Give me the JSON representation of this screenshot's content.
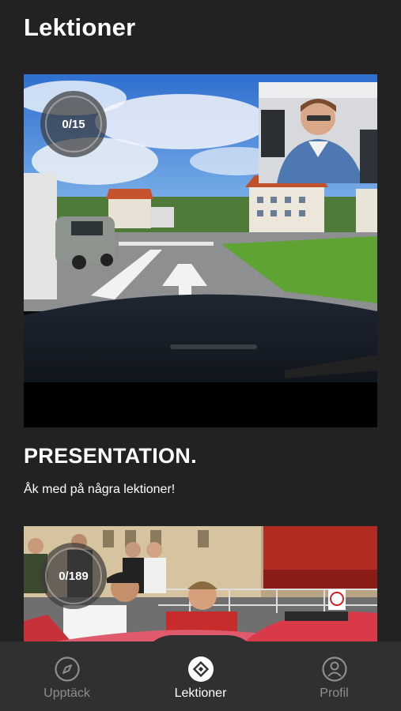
{
  "header": {
    "title": "Lektioner"
  },
  "cards": [
    {
      "title": "PRESENTATION.",
      "subtitle": "Åk med på några lektioner!",
      "progress": "0/15"
    },
    {
      "progress": "0/189"
    }
  ],
  "nav": {
    "items": [
      {
        "label": "Upptäck",
        "icon": "compass-icon",
        "active": false
      },
      {
        "label": "Lektioner",
        "icon": "lessons-icon",
        "active": true
      },
      {
        "label": "Profil",
        "icon": "user-icon",
        "active": false
      }
    ]
  },
  "colors": {
    "background": "#222222",
    "nav_background": "#303030",
    "active": "#ffffff",
    "inactive": "#8e8e8e"
  }
}
